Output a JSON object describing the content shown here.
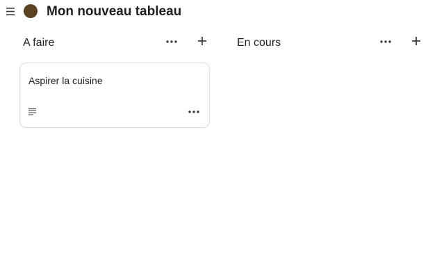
{
  "header": {
    "title": "Mon nouveau tableau",
    "board_color": "#5b4220",
    "menu_icon": "hamburger-menu-icon"
  },
  "columns": [
    {
      "title": "A faire",
      "more_icon": "more-horizontal-icon",
      "add_icon": "plus-icon",
      "cards": [
        {
          "title": "Aspirer la cuisine",
          "description_icon": "description-lines-icon",
          "more_icon": "more-horizontal-icon"
        }
      ]
    },
    {
      "title": "En cours",
      "more_icon": "more-horizontal-icon",
      "add_icon": "plus-icon",
      "cards": []
    }
  ],
  "colors": {
    "text": "#1f1f1f",
    "icon": "#3c3c3c",
    "card_border": "#dcdcdc"
  }
}
